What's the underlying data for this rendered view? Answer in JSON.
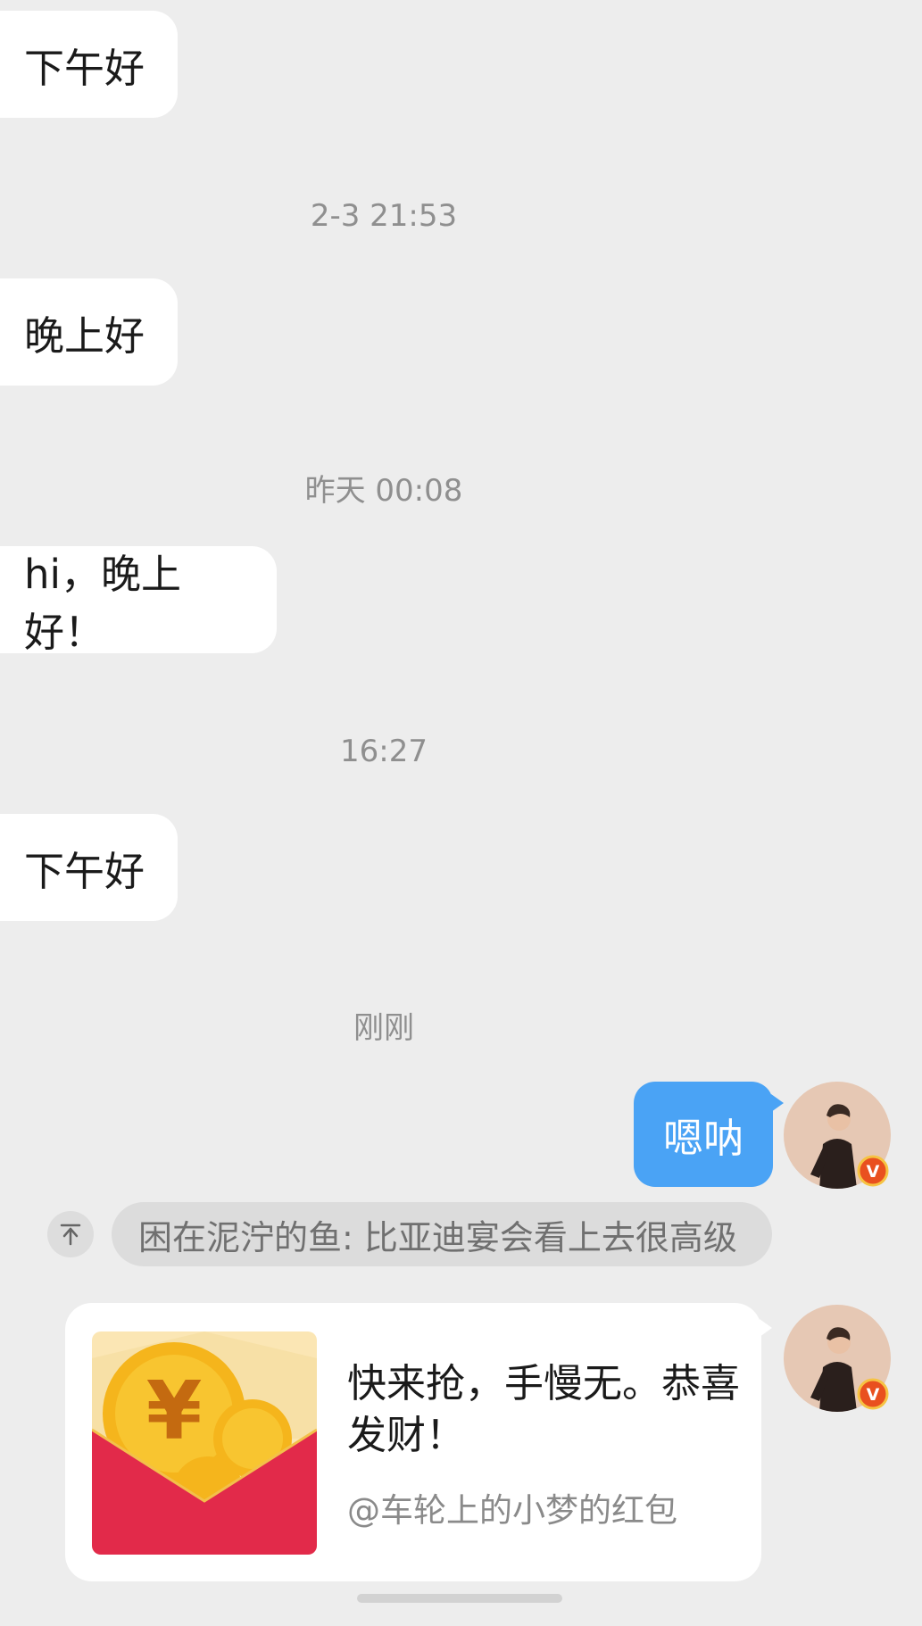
{
  "messages": {
    "m1": "下午好",
    "m2": "晚上好",
    "m3": "hi，晚上好！",
    "m4": "下午好",
    "sent": "嗯呐"
  },
  "timestamps": {
    "t1": "2-3 21:53",
    "t2": "昨天 00:08",
    "t3": "16:27",
    "t4": "刚刚"
  },
  "quote": {
    "text": "困在泥泞的鱼: 比亚迪宴会看上去很高级",
    "icon": "pin-top-icon"
  },
  "red_packet": {
    "title": "快来抢，手慢无。恭喜发财！",
    "subtitle": "@车轮上的小梦的红包",
    "icon": "red-envelope-icon"
  },
  "colors": {
    "background": "#ededed",
    "sent_bubble": "#4aa3f5",
    "verified_badge": "#e9501f"
  }
}
